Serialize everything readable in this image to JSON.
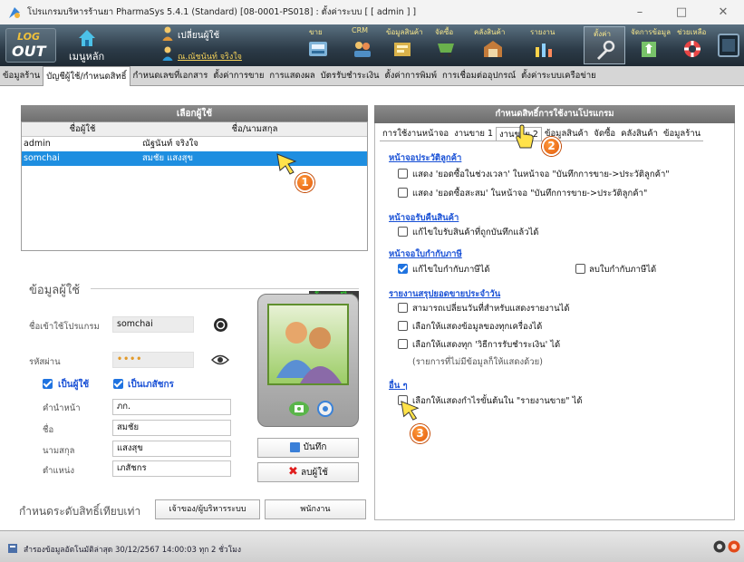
{
  "window": {
    "title": "โปรแกรมบริหารร้านยา PharmaSys 5.4.1 (Standard) [08-0001-PS018] : ตั้งค่าระบบ [ [ admin ] ]"
  },
  "toolbar": {
    "logout_top": "LOG",
    "logout_bottom": "OUT",
    "main_menu": "เมนูหลัก",
    "change_user": "เปลี่ยนผู้ใช้",
    "current_user": "ณ.ณัชนันท์ จริงใจ",
    "sell": "ขาย",
    "crm": "CRM",
    "product_info": "ข้อมูลสินค้า",
    "purchase": "จัดซื้อ",
    "warehouse": "คลังสินค้า",
    "report": "รายงาน",
    "settings": "ตั้งค่า",
    "manage_data": "จัดการข้อมูล",
    "help": "ช่วยเหลือ"
  },
  "main_tabs": [
    "ข้อมูลร้าน",
    "บัญชีผู้ใช้/กำหนดสิทธิ์",
    "กำหนดเลขที่เอกสาร",
    "ตั้งค่าการขาย",
    "การแสดงผล",
    "บัตรรับชำระเงิน",
    "ตั้งค่าการพิมพ์",
    "การเชื่อมต่ออุปกรณ์",
    "ตั้งค่าระบบเครือข่าย"
  ],
  "user_list": {
    "title": "เลือกผู้ใช้",
    "col_user": "ชื่อผู้ใช้",
    "col_name": "ชื่อ/นามสกุล",
    "rows": [
      {
        "user": "admin",
        "name": "ณัฐนันท์ จริงใจ"
      },
      {
        "user": "somchai",
        "name": "สมชัย แสงสุข"
      }
    ]
  },
  "user_info": {
    "group_title": "ข้อมูลผู้ใช้",
    "new_edit": "โหมดแก้ไข",
    "login_label": "ชื่อเข้าใช้โปรแกรม",
    "login_value": "somchai",
    "password_label": "รหัสผ่าน",
    "password_value": "••••",
    "is_user_label": "เป็นผู้ใช้",
    "is_pharmacist_label": "เป็นเภสัชกร",
    "prefix_label": "คำนำหน้า",
    "prefix_value": "ภก.",
    "first_label": "ชื่อ",
    "first_value": "สมชัย",
    "last_label": "นามสกุล",
    "last_value": "แสงสุข",
    "position_label": "ตำแหน่ง",
    "position_value": "เภสัชกร",
    "save_button": "บันทึก",
    "delete_button": "ลบผู้ใช้"
  },
  "permission_level": {
    "label": "กำหนดระดับสิทธิ์เทียบเท่า",
    "owner_button": "เจ้าของ/ผู้บริหารระบบ",
    "staff_button": "พนักงาน"
  },
  "permissions": {
    "title": "กำหนดสิทธิ์การใช้งานโปรแกรม",
    "tabs": [
      "การใช้งานหน้าจอ",
      "งานขาย 1",
      "งานขาย 2",
      "ข้อมูลสินค้า",
      "จัดซื้อ",
      "คลังสินค้า",
      "ข้อมูลร้าน"
    ],
    "sections": [
      {
        "heading": "หน้าจอประวัติลูกค้า",
        "options": [
          "แสดง 'ยอดซื้อในช่วงเวลา' ในหน้าจอ \"บันทึกการขาย->ประวัติลูกค้า\"",
          "แสดง 'ยอดซื้อสะสม' ในหน้าจอ \"บันทึกการขาย->ประวัติลูกค้า\""
        ]
      },
      {
        "heading": "หน้าจอรับคืนสินค้า",
        "options": [
          "แก้ไขใบรับสินค้าที่ถูกบันทึกแล้วได้"
        ]
      },
      {
        "heading": "หน้าจอใบกำกับภาษี",
        "options": [
          "แก้ไขใบกำกับภาษีได้",
          "ลบใบกำกับภาษีได้"
        ]
      },
      {
        "heading": "รายงานสรุปยอดขายประจำวัน",
        "options": [
          "สามารถเปลี่ยนวันที่สำหรับแสดงรายงานได้",
          "เลือกให้แสดงข้อมูลของทุกเครื่องได้",
          "เลือกให้แสดงทุก 'วิธีการรับชำระเงิน' ได้"
        ],
        "note": "(รายการที่ไม่มีข้อมูลก็ให้แสดงด้วย)"
      },
      {
        "heading": "อื่น ๆ",
        "options": [
          "เลือกให้แสดงกำไรขั้นต้นใน \"รายงานขาย\" ได้"
        ]
      }
    ]
  },
  "callouts": [
    "1",
    "2",
    "3"
  ],
  "status": {
    "text": "สำรองข้อมูลอัตโนมัติล่าสุด  30/12/2567 14:00:03  ทุก 2 ชั่วโมง"
  },
  "colors": {
    "selection": "#1e8ee0",
    "link_heading": "#1b52d6",
    "callout": "#e25a0c",
    "toolbar": "#2c3b48"
  }
}
